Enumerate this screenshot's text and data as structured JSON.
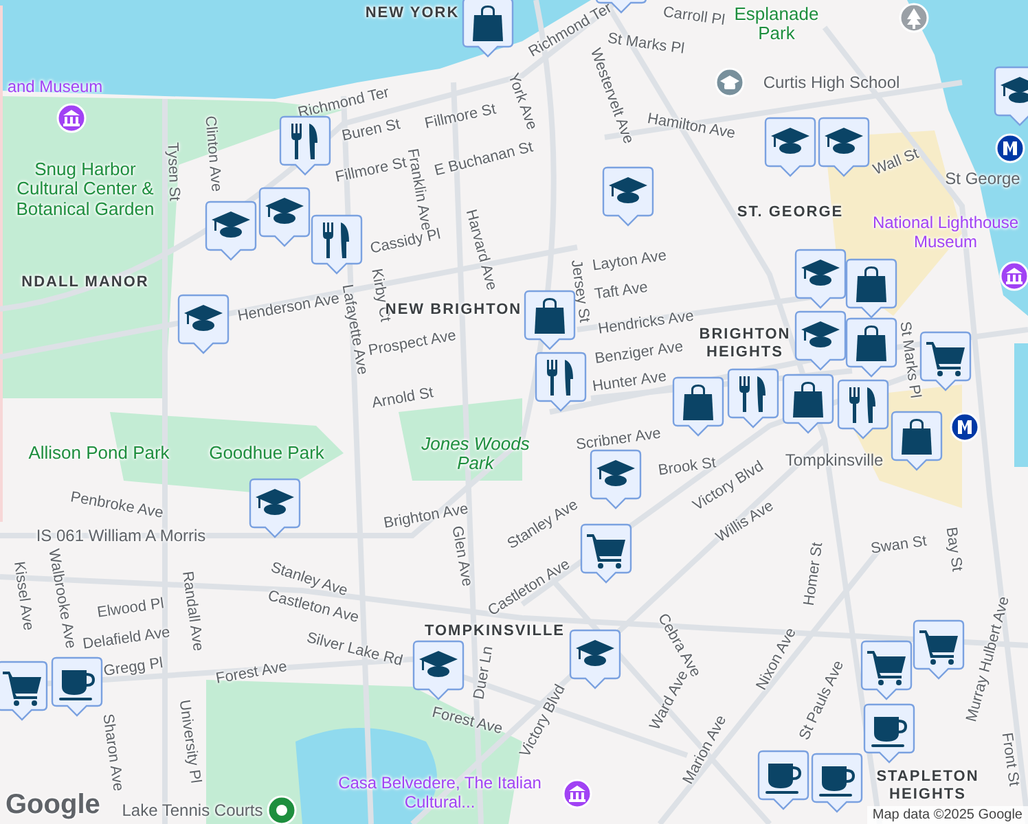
{
  "map": {
    "labels": [
      {
        "text": "NEW YORK",
        "kind": "area"
      },
      {
        "text": "Richmond Ter",
        "kind": "street"
      },
      {
        "text": "Buren St",
        "kind": "street"
      },
      {
        "text": "Fillmore St",
        "kind": "street"
      },
      {
        "text": "Fillmore St",
        "kind": "street"
      },
      {
        "text": "E Buchanan St",
        "kind": "street"
      },
      {
        "text": "Tysen St",
        "kind": "street"
      },
      {
        "text": "Clinton Ave",
        "kind": "street"
      },
      {
        "text": "Franklin Ave",
        "kind": "street"
      },
      {
        "text": "Harvard Ave",
        "kind": "street"
      },
      {
        "text": "Cassidy Pl",
        "kind": "street"
      },
      {
        "text": "Kirby Ct",
        "kind": "street"
      },
      {
        "text": "Lafayette Ave",
        "kind": "street"
      },
      {
        "text": "Henderson Ave",
        "kind": "street"
      },
      {
        "text": "Prospect Ave",
        "kind": "street"
      },
      {
        "text": "Arnold St",
        "kind": "street"
      },
      {
        "text": "York Ave",
        "kind": "street"
      },
      {
        "text": "Richmond Ter",
        "kind": "street"
      },
      {
        "text": "Westervelt Ave",
        "kind": "street"
      },
      {
        "text": "St Marks Pl",
        "kind": "street"
      },
      {
        "text": "Carroll Pl",
        "kind": "street"
      },
      {
        "text": "Hamilton Ave",
        "kind": "street"
      },
      {
        "text": "Wall St",
        "kind": "street"
      },
      {
        "text": "Layton Ave",
        "kind": "street"
      },
      {
        "text": "Taft Ave",
        "kind": "street"
      },
      {
        "text": "Hendricks Ave",
        "kind": "street"
      },
      {
        "text": "Benziger Ave",
        "kind": "street"
      },
      {
        "text": "Hunter Ave",
        "kind": "street"
      },
      {
        "text": "Scribner Ave",
        "kind": "street"
      },
      {
        "text": "Jersey St",
        "kind": "street"
      },
      {
        "text": "St Marks Pl",
        "kind": "street"
      },
      {
        "text": "Brook St",
        "kind": "street"
      },
      {
        "text": "Victory Blvd",
        "kind": "street"
      },
      {
        "text": "Willis Ave",
        "kind": "street"
      },
      {
        "text": "Stanley Ave",
        "kind": "street"
      },
      {
        "text": "Brighton Ave",
        "kind": "street"
      },
      {
        "text": "Glen Ave",
        "kind": "street"
      },
      {
        "text": "Stanley Ave",
        "kind": "street"
      },
      {
        "text": "Castleton Ave",
        "kind": "street"
      },
      {
        "text": "Castleton Ave",
        "kind": "street"
      },
      {
        "text": "Silver Lake Rd",
        "kind": "street"
      },
      {
        "text": "Forest Ave",
        "kind": "street"
      },
      {
        "text": "Forest Ave",
        "kind": "street"
      },
      {
        "text": "Duer Ln",
        "kind": "street"
      },
      {
        "text": "Victory Blvd",
        "kind": "street"
      },
      {
        "text": "Cebra Ave",
        "kind": "street"
      },
      {
        "text": "Ward Ave",
        "kind": "street"
      },
      {
        "text": "Marion Ave",
        "kind": "street"
      },
      {
        "text": "Nixon Ave",
        "kind": "street"
      },
      {
        "text": "St Pauls Ave",
        "kind": "street"
      },
      {
        "text": "Homer St",
        "kind": "street"
      },
      {
        "text": "Swan St",
        "kind": "street"
      },
      {
        "text": "Bay St",
        "kind": "street"
      },
      {
        "text": "Murray Hulbert Ave",
        "kind": "street"
      },
      {
        "text": "Front St",
        "kind": "street"
      },
      {
        "text": "Penbroke Ave",
        "kind": "street"
      },
      {
        "text": "Kissel Ave",
        "kind": "street"
      },
      {
        "text": "Walbrooke Ave",
        "kind": "street"
      },
      {
        "text": "Elwood Pl",
        "kind": "street"
      },
      {
        "text": "Delafield Ave",
        "kind": "street"
      },
      {
        "text": "Gregg Pl",
        "kind": "street"
      },
      {
        "text": "Randall Ave",
        "kind": "street"
      },
      {
        "text": "Sharon Ave",
        "kind": "street"
      },
      {
        "text": "University Pl",
        "kind": "street"
      },
      {
        "text": "NEW BRIGHTON",
        "kind": "area"
      },
      {
        "text": "ST. GEORGE",
        "kind": "area"
      },
      {
        "text": "NDALL MANOR",
        "kind": "area"
      },
      {
        "text": "TOMPKINSVILLE",
        "kind": "area"
      },
      {
        "text": "BRIGHTON HEIGHTS",
        "kind": "area"
      },
      {
        "text": "STAPLETON HEIGHTS",
        "kind": "area"
      },
      {
        "text": "Snug Harbor Cultural Center & Botanical Garden",
        "kind": "park"
      },
      {
        "text": "Allison Pond Park",
        "kind": "park"
      },
      {
        "text": "Goodhue Park",
        "kind": "park"
      },
      {
        "text": "Jones Woods Park",
        "kind": "park-italic"
      },
      {
        "text": "Esplanade Park",
        "kind": "park"
      },
      {
        "text": "and Museum",
        "kind": "museum"
      },
      {
        "text": "National Lighthouse Museum",
        "kind": "museum"
      },
      {
        "text": "Casa Belvedere, The Italian Cultural...",
        "kind": "museum"
      },
      {
        "text": "Curtis High School",
        "kind": "place"
      },
      {
        "text": "IS 061 William A Morris",
        "kind": "place"
      },
      {
        "text": "St George",
        "kind": "place"
      },
      {
        "text": "Tompkinsville",
        "kind": "place"
      },
      {
        "text": "Lake Tennis Courts",
        "kind": "place"
      }
    ],
    "poi_icons": [
      {
        "kind": "museum"
      },
      {
        "kind": "museum"
      },
      {
        "kind": "museum"
      },
      {
        "kind": "school"
      },
      {
        "kind": "transit"
      },
      {
        "kind": "transit"
      },
      {
        "kind": "park"
      },
      {
        "kind": "place"
      }
    ],
    "markers": [
      {
        "kind": "shopping"
      },
      {
        "kind": "shopping"
      },
      {
        "kind": "restaurant"
      },
      {
        "kind": "school"
      },
      {
        "kind": "school"
      },
      {
        "kind": "restaurant"
      },
      {
        "kind": "school"
      },
      {
        "kind": "school"
      },
      {
        "kind": "shopping"
      },
      {
        "kind": "restaurant"
      },
      {
        "kind": "school"
      },
      {
        "kind": "school"
      },
      {
        "kind": "school"
      },
      {
        "kind": "shopping"
      },
      {
        "kind": "school"
      },
      {
        "kind": "shopping"
      },
      {
        "kind": "restaurant"
      },
      {
        "kind": "shopping"
      },
      {
        "kind": "restaurant"
      },
      {
        "kind": "shopping"
      },
      {
        "kind": "grocery"
      },
      {
        "kind": "shopping"
      },
      {
        "kind": "school"
      },
      {
        "kind": "grocery"
      },
      {
        "kind": "school"
      },
      {
        "kind": "school"
      },
      {
        "kind": "school"
      },
      {
        "kind": "grocery"
      },
      {
        "kind": "cafe"
      },
      {
        "kind": "grocery"
      },
      {
        "kind": "grocery"
      },
      {
        "kind": "cafe"
      },
      {
        "kind": "cafe"
      },
      {
        "kind": "cafe"
      },
      {
        "kind": "school"
      }
    ]
  },
  "logo": "Google",
  "attribution": "Map data ©2025 Google"
}
